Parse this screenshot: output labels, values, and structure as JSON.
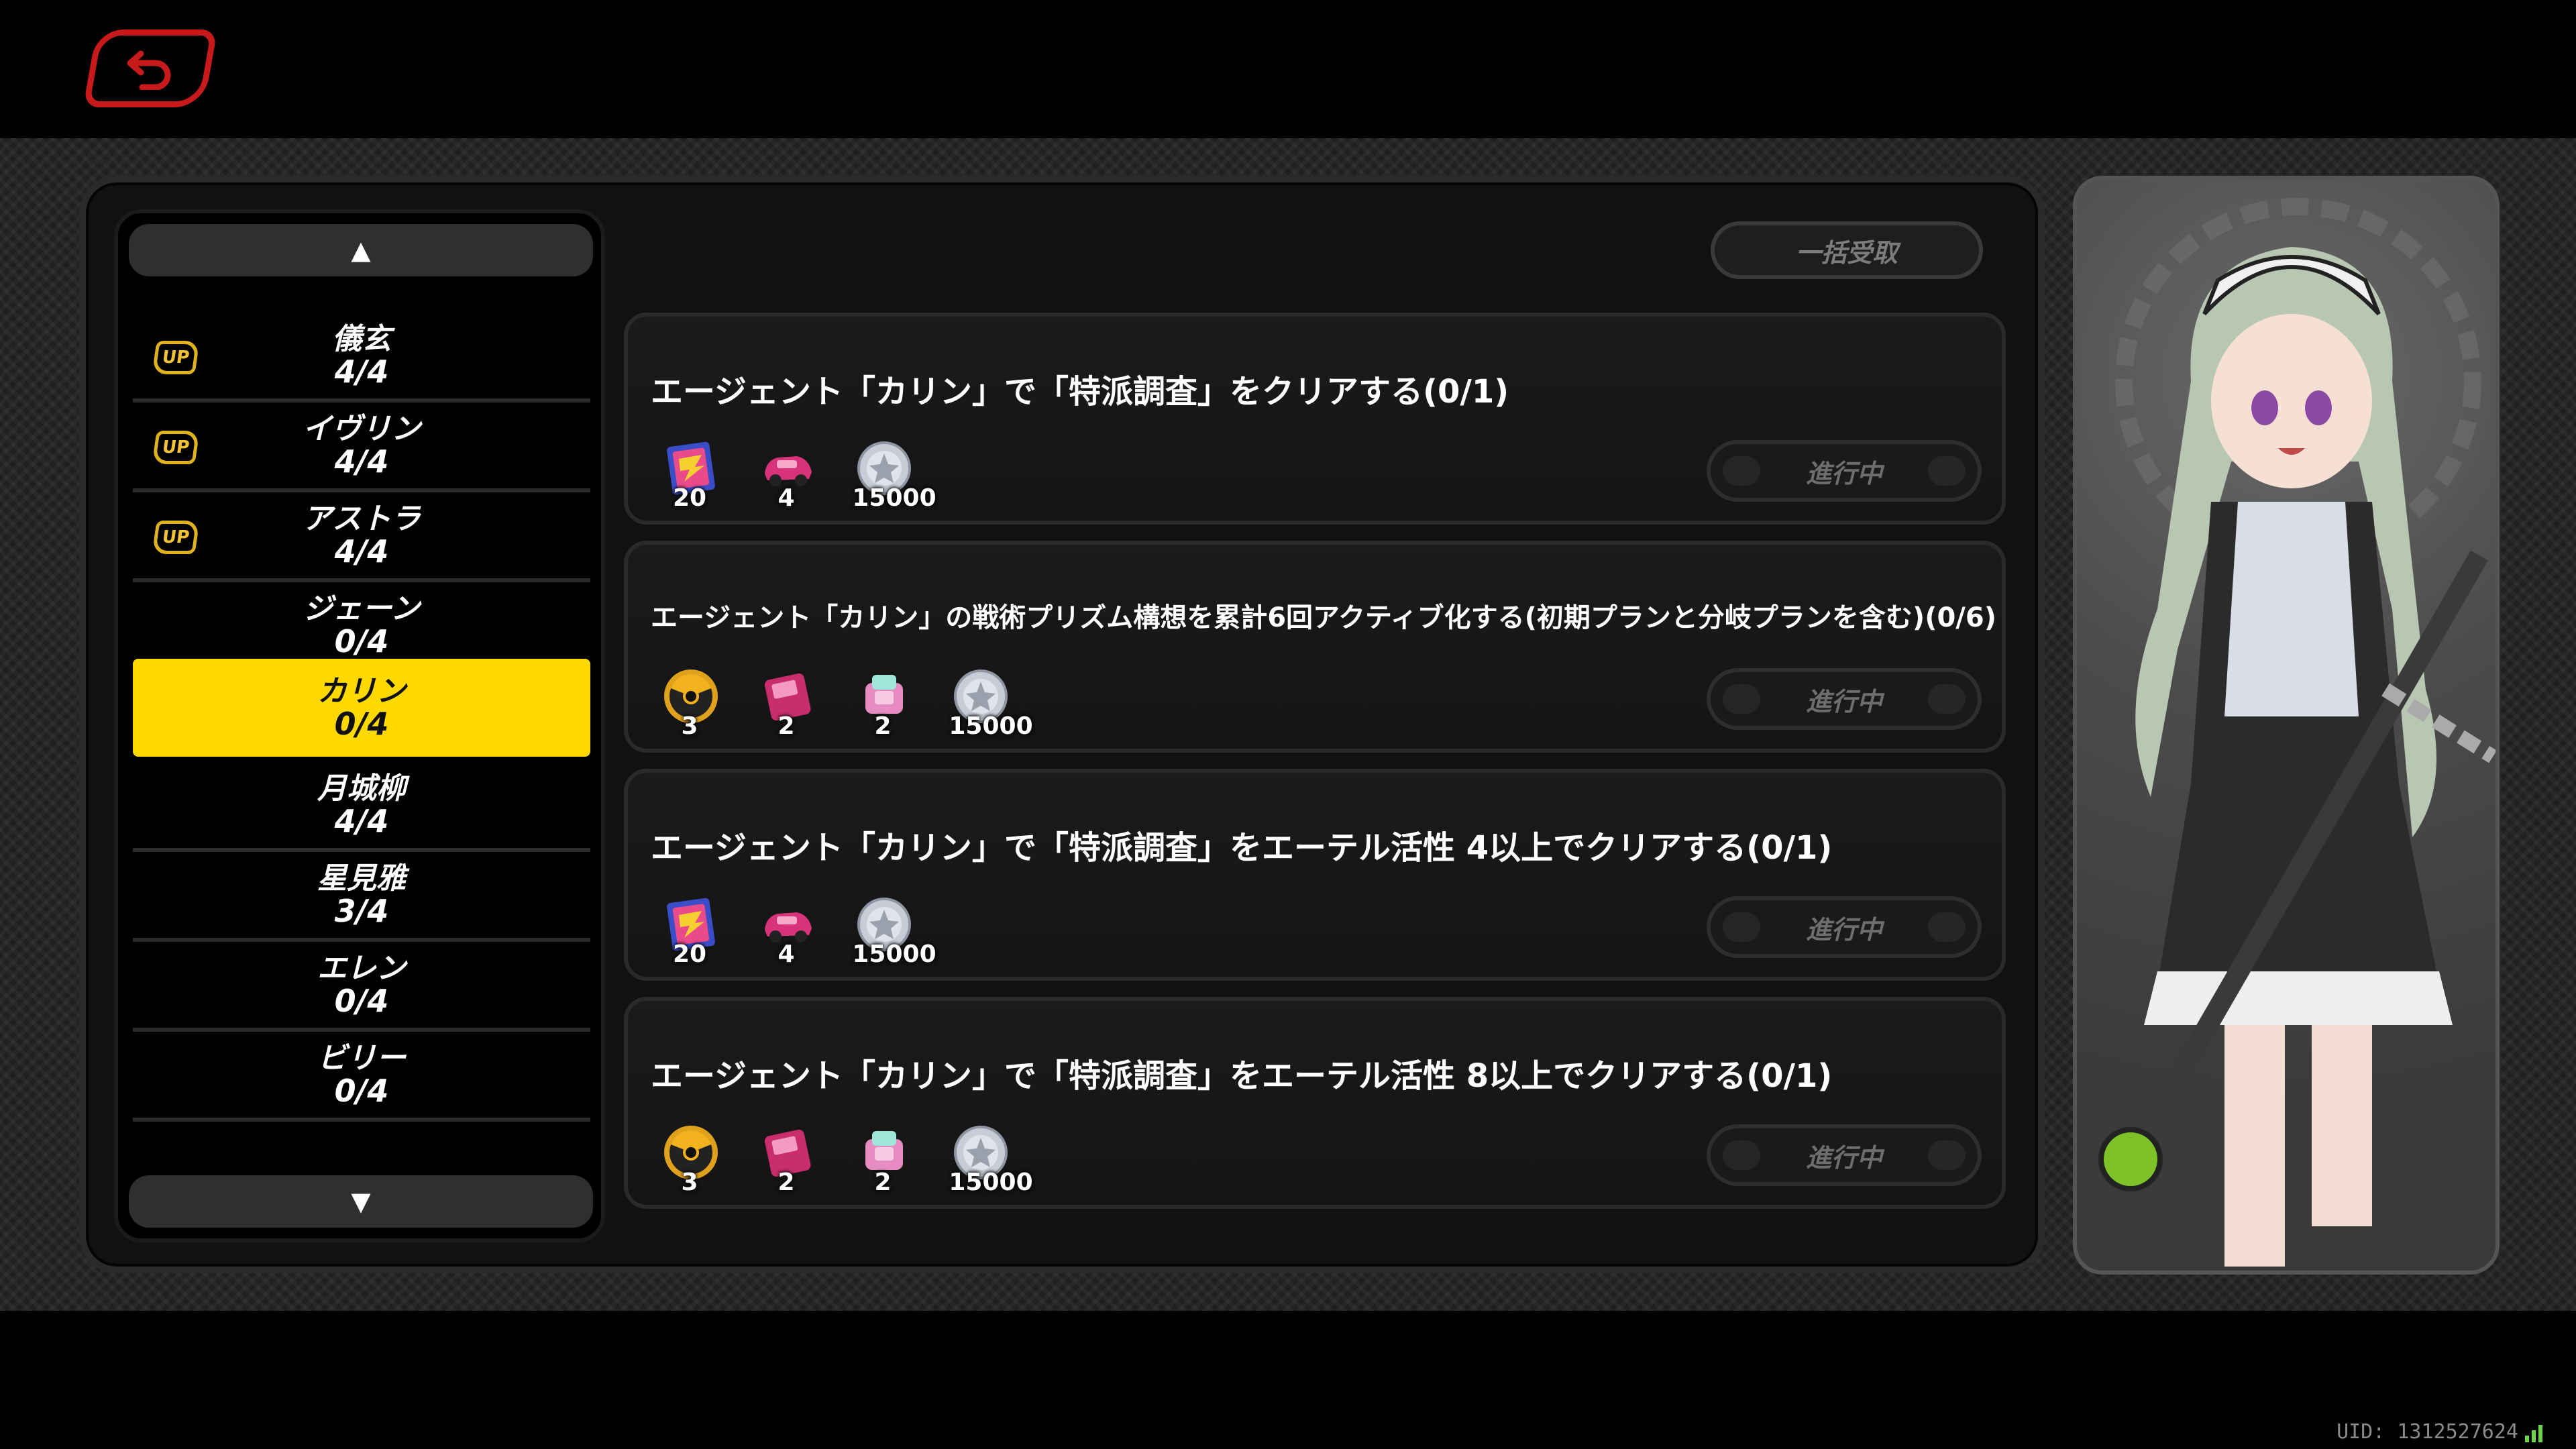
{
  "back_button": {
    "icon": "undo-arrow-icon"
  },
  "agent_list": {
    "items": [
      {
        "name": "儀玄",
        "progress": "4/4",
        "up_badge": "UP"
      },
      {
        "name": "イヴリン",
        "progress": "4/4",
        "up_badge": "UP"
      },
      {
        "name": "アストラ",
        "progress": "4/4",
        "up_badge": "UP"
      },
      {
        "name": "ジェーン",
        "progress": "0/4"
      },
      {
        "name": "カリン",
        "progress": "0/4",
        "selected": true
      },
      {
        "name": "月城柳",
        "progress": "4/4"
      },
      {
        "name": "星見雅",
        "progress": "3/4"
      },
      {
        "name": "エレン",
        "progress": "0/4"
      },
      {
        "name": "ビリー",
        "progress": "0/4"
      }
    ]
  },
  "claim_all": {
    "label": "一括受取"
  },
  "missions": [
    {
      "title": "エージェント「カリン」で「特派調査」をクリアする(0/1)",
      "status": "進行中",
      "rewards": [
        {
          "icon": "film-tape-icon",
          "qty": "20"
        },
        {
          "icon": "pink-car-icon",
          "qty": "4"
        },
        {
          "icon": "silver-coin-icon",
          "qty": "15000"
        }
      ]
    },
    {
      "title": "エージェント「カリン」の戦術プリズム構想を累計6回アクティブ化する(初期プランと分岐プランを含む)(0/6)",
      "status": "進行中",
      "rewards": [
        {
          "icon": "gold-orb-icon",
          "qty": "3"
        },
        {
          "icon": "pink-disk-icon",
          "qty": "2"
        },
        {
          "icon": "pink-chip-icon",
          "qty": "2"
        },
        {
          "icon": "silver-coin-icon",
          "qty": "15000"
        }
      ]
    },
    {
      "title": "エージェント「カリン」で「特派調査」をエーテル活性 4以上でクリアする(0/1)",
      "status": "進行中",
      "rewards": [
        {
          "icon": "film-tape-icon",
          "qty": "20"
        },
        {
          "icon": "pink-car-icon",
          "qty": "4"
        },
        {
          "icon": "silver-coin-icon",
          "qty": "15000"
        }
      ]
    },
    {
      "title": "エージェント「カリン」で「特派調査」をエーテル活性 8以上でクリアする(0/1)",
      "status": "進行中",
      "rewards": [
        {
          "icon": "gold-orb-icon",
          "qty": "3"
        },
        {
          "icon": "pink-disk-icon",
          "qty": "2"
        },
        {
          "icon": "pink-chip-icon",
          "qty": "2"
        },
        {
          "icon": "silver-coin-icon",
          "qty": "15000"
        }
      ]
    }
  ],
  "portrait": {
    "icon": "character-portrait-icon"
  },
  "footer": {
    "uid": "UID: 1312527624",
    "signal_icon": "signal-bars-icon"
  },
  "colors": {
    "accent": "#ffd900",
    "back_red": "#c81a1a",
    "up_gold": "#e0b21d"
  }
}
